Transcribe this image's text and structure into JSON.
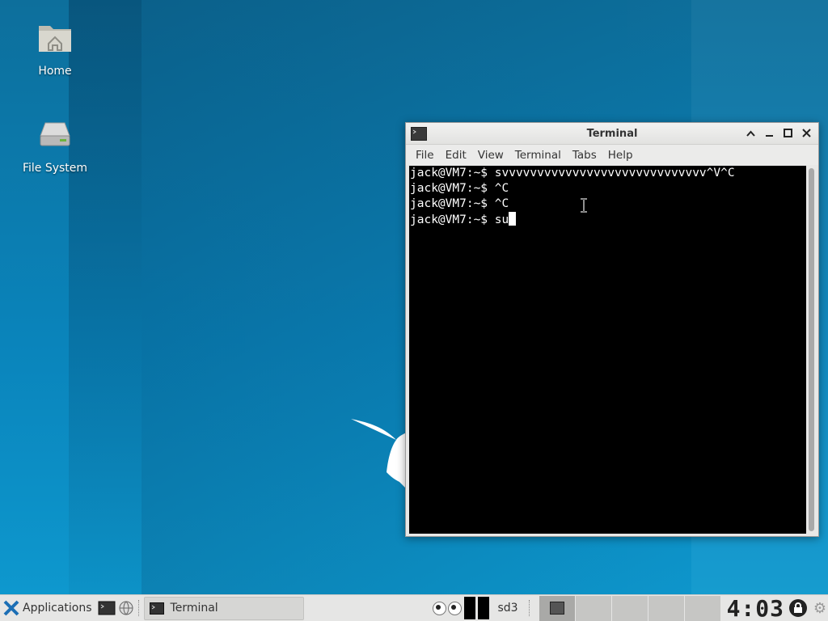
{
  "desktop": {
    "icons": [
      {
        "label": "Home",
        "icon": "home-folder-icon"
      },
      {
        "label": "File System",
        "icon": "drive-icon"
      }
    ]
  },
  "window": {
    "title": "Terminal",
    "controls": {
      "shade": "^",
      "minimize": "_",
      "maximize": "□",
      "close": "×"
    },
    "menu": [
      "File",
      "Edit",
      "View",
      "Terminal",
      "Tabs",
      "Help"
    ],
    "terminal_lines": [
      "jack@VM7:~$ svvvvvvvvvvvvvvvvvvvvvvvvvvvvv^V^C",
      "jack@VM7:~$ ^C",
      "jack@VM7:~$ ^C",
      "jack@VM7:~$ su"
    ]
  },
  "taskbar": {
    "applications_label": "Applications",
    "task_label": "Terminal",
    "disk_label": "sd3",
    "clock": "4:03",
    "colors": {
      "accent": "#1c6fb5",
      "panel": "#e6e6e5"
    }
  }
}
